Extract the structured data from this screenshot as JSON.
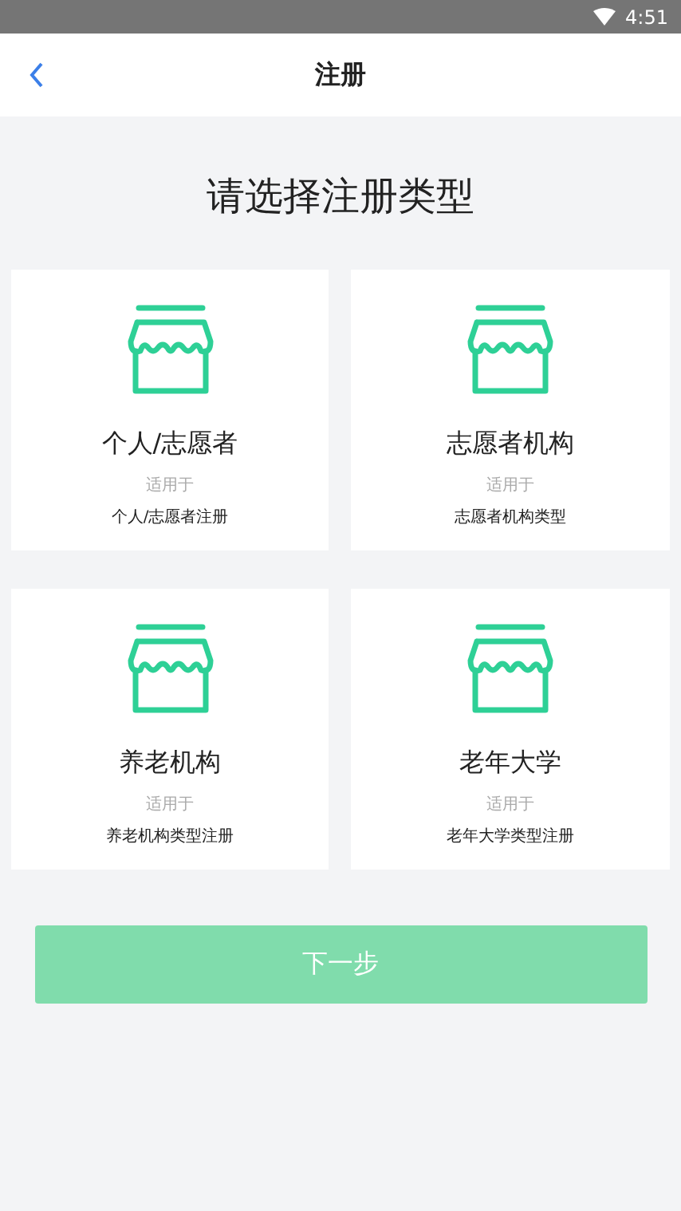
{
  "status_bar": {
    "time": "4:51"
  },
  "header": {
    "title": "注册"
  },
  "heading": "请选择注册类型",
  "types": [
    {
      "name": "个人/志愿者",
      "caption": "适用于",
      "description": "个人/志愿者注册",
      "selected": false
    },
    {
      "name": "志愿者机构",
      "caption": "适用于",
      "description": "志愿者机构类型",
      "selected": false
    },
    {
      "name": "养老机构",
      "caption": "适用于",
      "description": "养老机构类型注册",
      "selected": false
    },
    {
      "name": "老年大学",
      "caption": "适用于",
      "description": "老年大学类型注册",
      "selected": false
    }
  ],
  "next_button": {
    "label": "下一步",
    "disabled": true
  }
}
